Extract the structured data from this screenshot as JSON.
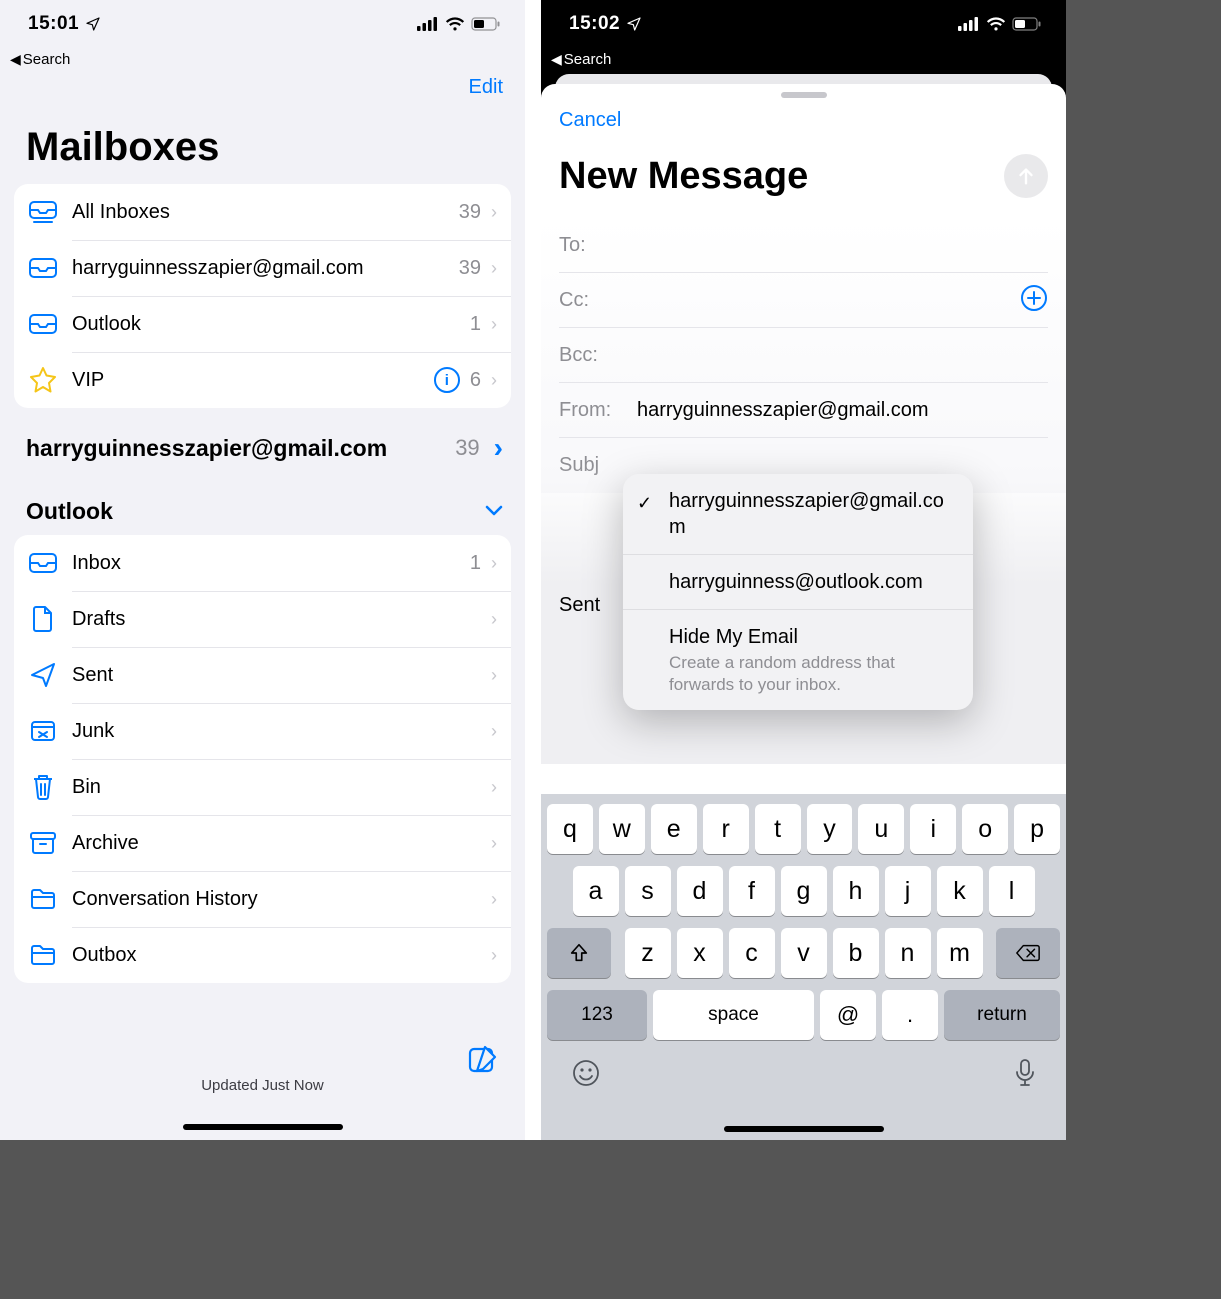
{
  "left": {
    "status": {
      "time": "15:01",
      "back_label": "Search"
    },
    "nav": {
      "edit": "Edit"
    },
    "title": "Mailboxes",
    "top_box": [
      {
        "icon": "inbox-multi",
        "label": "All Inboxes",
        "count": "39"
      },
      {
        "icon": "inbox",
        "label": "harryguinnesszapier@gmail.com",
        "count": "39"
      },
      {
        "icon": "inbox",
        "label": "Outlook",
        "count": "1"
      },
      {
        "icon": "star",
        "label": "VIP",
        "info": true,
        "count": "6"
      }
    ],
    "sections": [
      {
        "label": "harryguinnesszapier@gmail.com",
        "count": "39",
        "chev": "right",
        "rows": []
      },
      {
        "label": "Outlook",
        "count": "",
        "chev": "down",
        "rows": [
          {
            "icon": "inbox",
            "label": "Inbox",
            "count": "1"
          },
          {
            "icon": "doc",
            "label": "Drafts",
            "count": ""
          },
          {
            "icon": "send",
            "label": "Sent",
            "count": ""
          },
          {
            "icon": "junk",
            "label": "Junk",
            "count": ""
          },
          {
            "icon": "trash",
            "label": "Bin",
            "count": ""
          },
          {
            "icon": "archive",
            "label": "Archive",
            "count": ""
          },
          {
            "icon": "folder",
            "label": "Conversation History",
            "count": ""
          },
          {
            "icon": "folder",
            "label": "Outbox",
            "count": ""
          }
        ]
      }
    ],
    "footer": {
      "status": "Updated Just Now"
    }
  },
  "right": {
    "status": {
      "time": "15:02",
      "back_label": "Search"
    },
    "compose": {
      "cancel": "Cancel",
      "title": "New Message",
      "fields": {
        "to_label": "To:",
        "cc_label": "Cc:",
        "bcc_label": "Bcc:",
        "from_label": "From:",
        "from_value": "harryguinnesszapier@gmail.com",
        "subject_label": "Subj"
      },
      "body_preview": "Sent"
    },
    "popover": {
      "items": [
        {
          "checked": true,
          "label": "harryguinnesszapier@gmail.com"
        },
        {
          "checked": false,
          "label": "harryguinness@outlook.com"
        },
        {
          "checked": false,
          "label": "Hide My Email",
          "sub": "Create a random address that forwards to your inbox."
        }
      ]
    },
    "keyboard": {
      "row1": [
        "q",
        "w",
        "e",
        "r",
        "t",
        "y",
        "u",
        "i",
        "o",
        "p"
      ],
      "row2": [
        "a",
        "s",
        "d",
        "f",
        "g",
        "h",
        "j",
        "k",
        "l"
      ],
      "row3": [
        "z",
        "x",
        "c",
        "v",
        "b",
        "n",
        "m"
      ],
      "numbers": "123",
      "space": "space",
      "at": "@",
      "dot": ".",
      "ret": "return"
    }
  }
}
